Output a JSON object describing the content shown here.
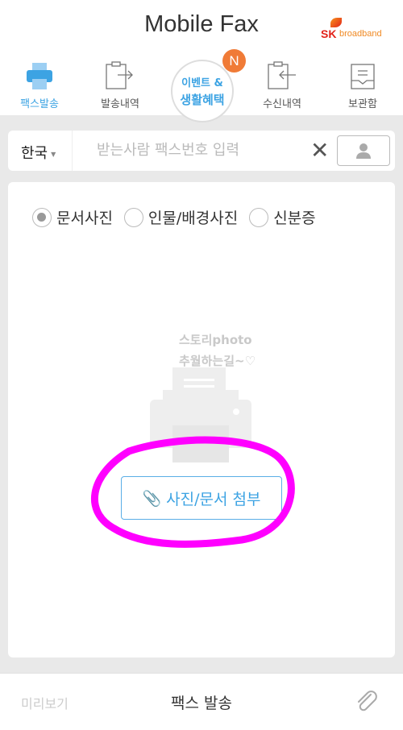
{
  "header": {
    "title": "Mobile Fax",
    "logo_text": "SK broadband"
  },
  "tabs": [
    {
      "label": "팩스발송",
      "icon": "printer-icon",
      "active": true
    },
    {
      "label": "발송내역",
      "icon": "sent-history-icon"
    },
    {
      "label": "수신내역",
      "icon": "received-history-icon"
    },
    {
      "label": "보관함",
      "icon": "archive-icon"
    }
  ],
  "event": {
    "line1": "이벤트 &",
    "line2": "생활혜택",
    "badge": "N"
  },
  "recipient": {
    "country": "한국",
    "placeholder": "받는사람 팩스번호 입력",
    "value": ""
  },
  "doc_types": [
    {
      "label": "문서사진",
      "selected": true
    },
    {
      "label": "인물/배경사진",
      "selected": false
    },
    {
      "label": "신분증",
      "selected": false
    }
  ],
  "watermark": {
    "line1": "스토리photo",
    "line2": "추월하는길~♡"
  },
  "attach_label": "사진/문서 첨부",
  "bottom": {
    "preview": "미리보기",
    "send": "팩스 발송"
  },
  "colors": {
    "accent": "#3ca3e3",
    "badge": "#f07b37",
    "annotation": "#ff00ff"
  }
}
